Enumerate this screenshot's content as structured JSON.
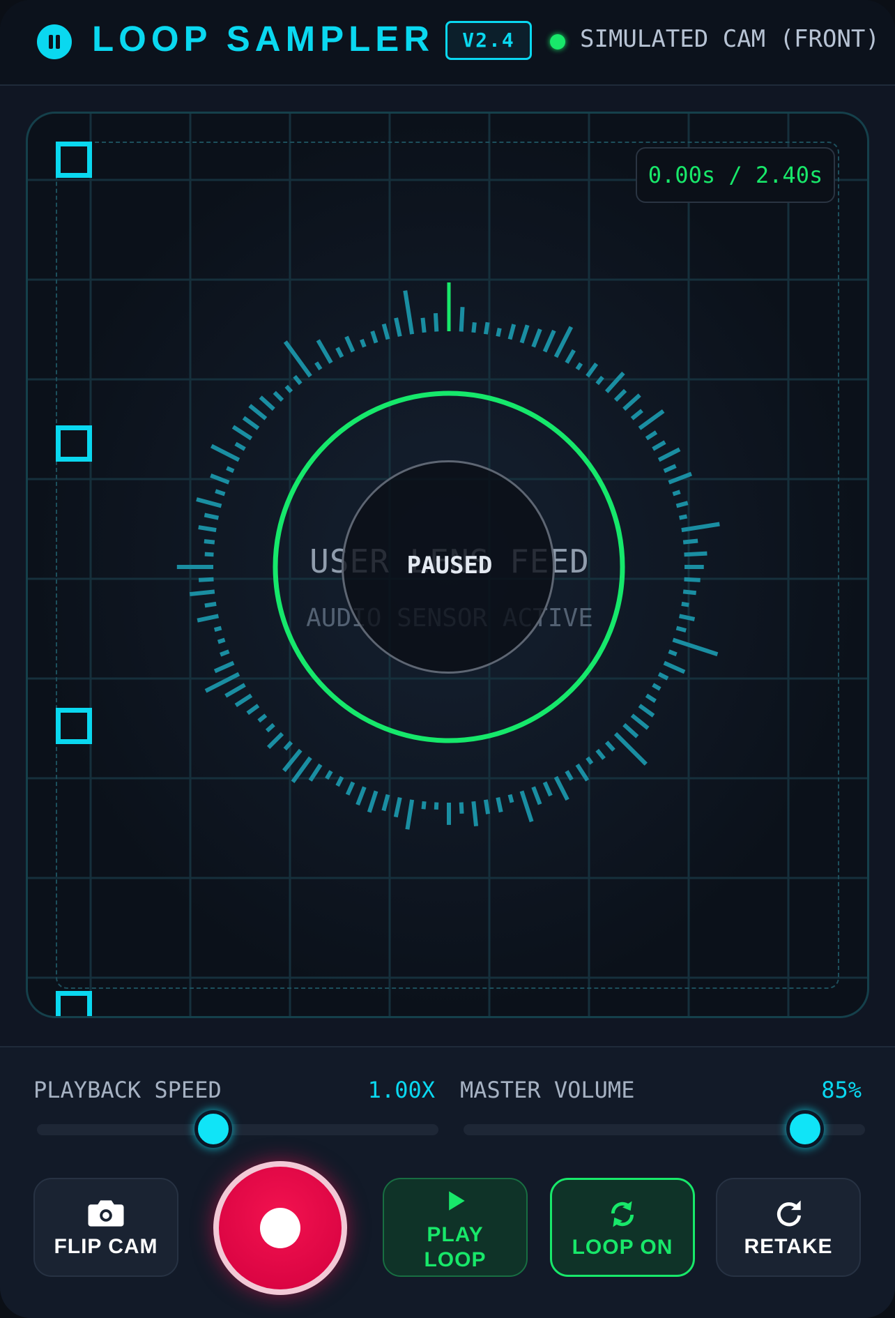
{
  "header": {
    "title": "LOOP SAMPLER",
    "version": "V2.4",
    "camera_status": "SIMULATED CAM (FRONT)"
  },
  "viewport": {
    "timer": "0.00s / 2.40s",
    "feed_title": "USER LENS FEED",
    "feed_subtitle": "AUDIO SENSOR ACTIVE",
    "overlay_status": "PAUSED"
  },
  "controls": {
    "playback_speed": {
      "label": "PLAYBACK SPEED",
      "value": "1.00X",
      "level": 0.44
    },
    "master_volume": {
      "label": "MASTER VOLUME",
      "value": "85%",
      "level": 0.85
    },
    "buttons": {
      "flip_cam": "FLIP CAM",
      "play_loop": "PLAY LOOP",
      "loop_toggle": "LOOP ON",
      "retake": "RETAKE"
    }
  },
  "colors": {
    "accent": "#0ad8f0",
    "active": "#18e86a",
    "record": "#e8104a"
  },
  "icons": {
    "logo": "pause-icon",
    "flip_cam": "camera-icon",
    "play_loop": "play-icon",
    "loop_toggle": "repeat-icon",
    "retake": "refresh-icon",
    "record": "record-icon"
  }
}
